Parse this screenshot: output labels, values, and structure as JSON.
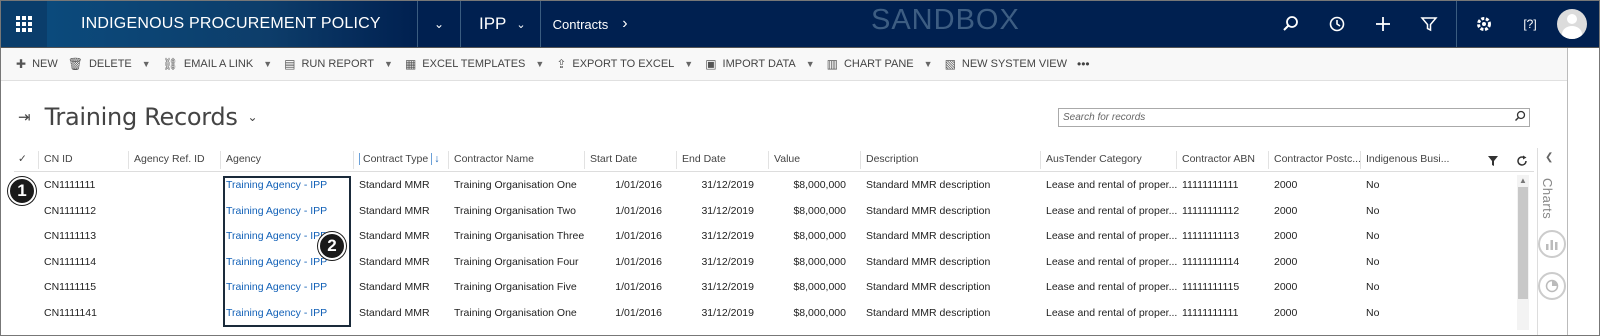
{
  "nav": {
    "app_title": "INDIGENOUS PROCUREMENT POLICY",
    "module": "IPP",
    "breadcrumb": "Contracts",
    "environment_label": "SANDBOX",
    "help_icon_text": "[?]"
  },
  "commands": [
    {
      "label": "NEW",
      "icon": "plus-icon",
      "dropdown": false
    },
    {
      "label": "DELETE",
      "icon": "trash-icon",
      "dropdown": true
    },
    {
      "label": "EMAIL A LINK",
      "icon": "link-icon",
      "dropdown": true
    },
    {
      "label": "RUN REPORT",
      "icon": "report-icon",
      "dropdown": true
    },
    {
      "label": "EXCEL TEMPLATES",
      "icon": "excel-icon",
      "dropdown": true
    },
    {
      "label": "EXPORT TO EXCEL",
      "icon": "export-excel-icon",
      "dropdown": true
    },
    {
      "label": "IMPORT DATA",
      "icon": "import-icon",
      "dropdown": true
    },
    {
      "label": "CHART PANE",
      "icon": "chart-icon",
      "dropdown": true
    },
    {
      "label": "NEW SYSTEM VIEW",
      "icon": "system-view-icon",
      "dropdown": false
    }
  ],
  "more_label": "•••",
  "view": {
    "title": "Training Records",
    "search_placeholder": "Search for records"
  },
  "columns": [
    "CN ID",
    "Agency Ref. ID",
    "Agency",
    "Contract Type",
    "Contractor Name",
    "Start Date",
    "End Date",
    "Value",
    "Description",
    "AusTender Category",
    "Contractor ABN",
    "Contractor Postc...",
    "Indigenous Busi..."
  ],
  "sort_indicator": "↓",
  "rows": [
    [
      "CN1111111",
      "",
      "Training Agency - IPP",
      "Standard MMR",
      "Training Organisation One",
      "1/01/2016",
      "31/12/2019",
      "$8,000,000",
      "Standard MMR description",
      "Lease and rental of proper...",
      "11111111111",
      "2000",
      "No"
    ],
    [
      "CN1111112",
      "",
      "Training Agency - IPP",
      "Standard MMR",
      "Training Organisation Two",
      "1/01/2016",
      "31/12/2019",
      "$8,000,000",
      "Standard MMR description",
      "Lease and rental of proper...",
      "11111111112",
      "2000",
      "No"
    ],
    [
      "CN1111113",
      "",
      "Training Agency - IPP",
      "Standard MMR",
      "Training Organisation Three",
      "1/01/2016",
      "31/12/2019",
      "$8,000,000",
      "Standard MMR description",
      "Lease and rental of proper...",
      "11111111113",
      "2000",
      "No"
    ],
    [
      "CN1111114",
      "",
      "Training Agency - IPP",
      "Standard MMR",
      "Training Organisation Four",
      "1/01/2016",
      "31/12/2019",
      "$8,000,000",
      "Standard MMR description",
      "Lease and rental of proper...",
      "11111111114",
      "2000",
      "No"
    ],
    [
      "CN1111115",
      "",
      "Training Agency - IPP",
      "Standard MMR",
      "Training Organisation Five",
      "1/01/2016",
      "31/12/2019",
      "$8,000,000",
      "Standard MMR description",
      "Lease and rental of proper...",
      "11111111115",
      "2000",
      "No"
    ],
    [
      "CN1111141",
      "",
      "Training Agency - IPP",
      "Standard MMR",
      "Training Organisation One",
      "1/01/2016",
      "31/12/2019",
      "$8,000,000",
      "Standard MMR description",
      "Lease and rental of proper...",
      "11111111111",
      "2000",
      "No"
    ]
  ],
  "side_panel": {
    "label": "Charts"
  },
  "callouts": [
    "1",
    "2"
  ]
}
